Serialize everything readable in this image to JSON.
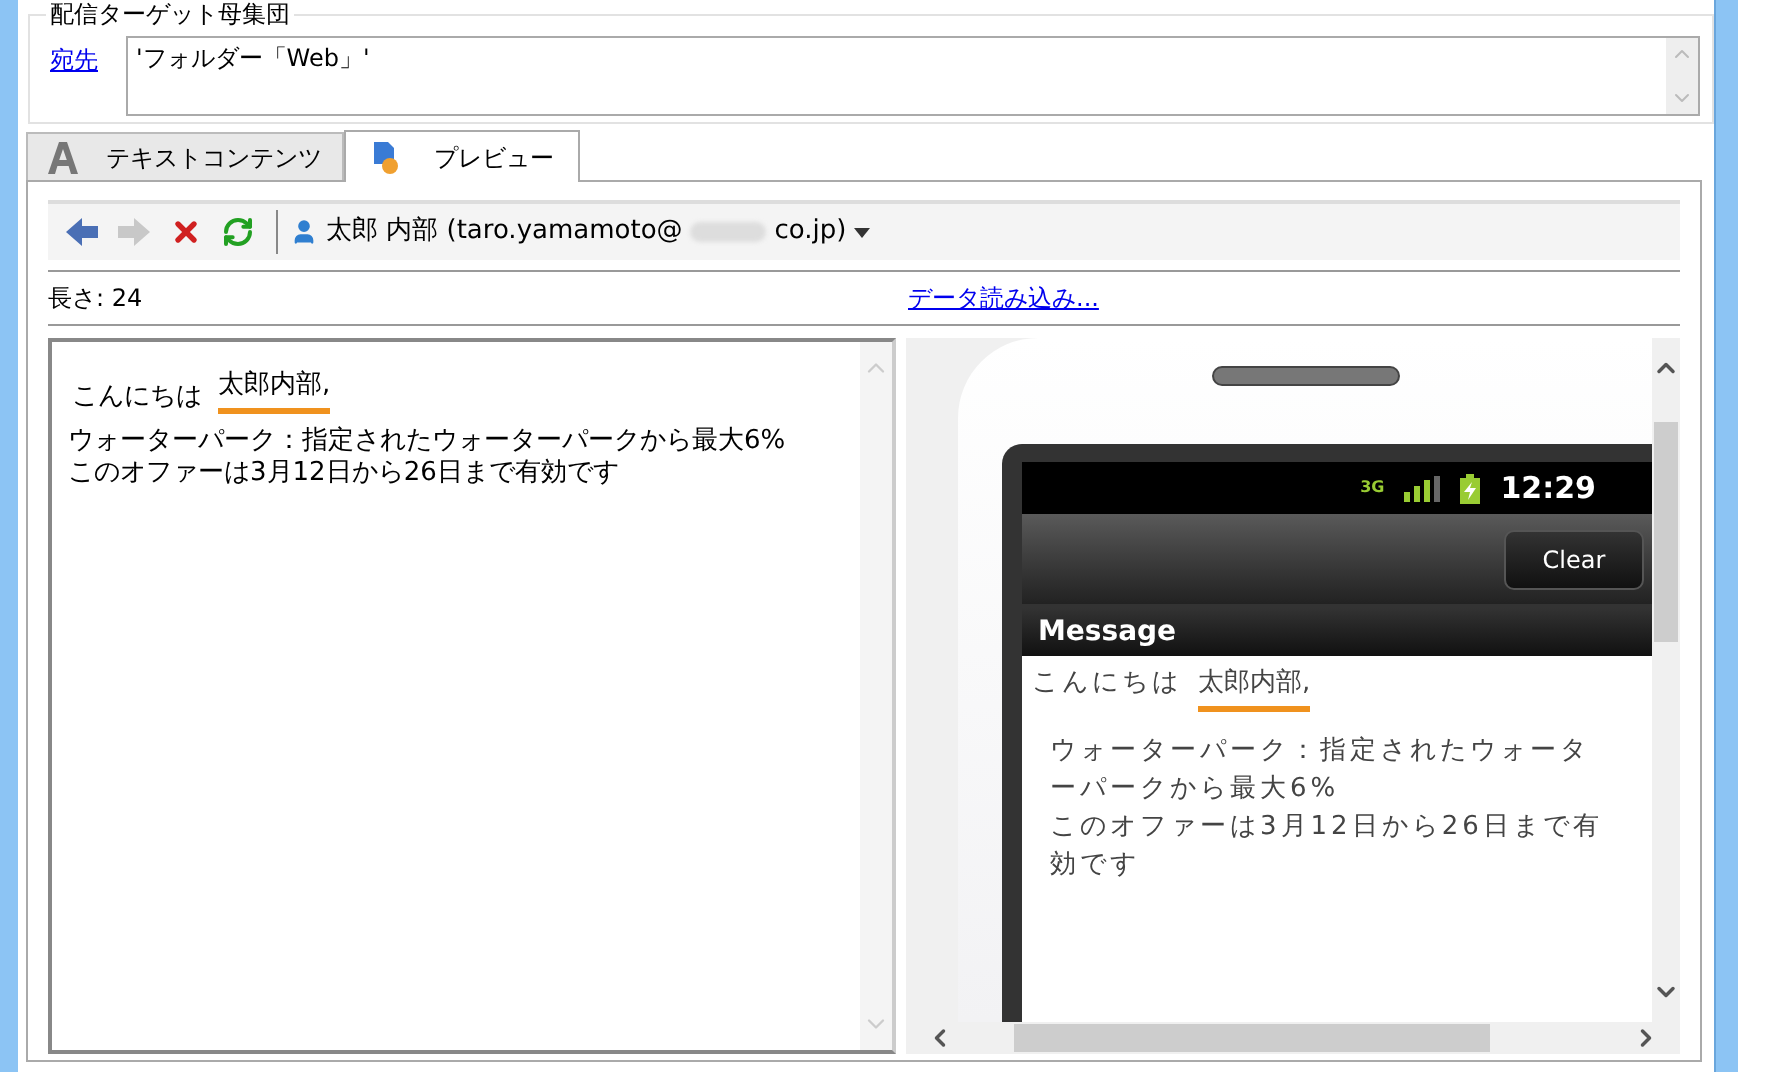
{
  "group": {
    "title": "配信ターゲット母集団",
    "to_link": "宛先",
    "to_value": "'フォルダー「Web」'"
  },
  "tabs": [
    {
      "label": "テキストコンテンツ",
      "selected": false,
      "kind": "text"
    },
    {
      "label": "プレビュー",
      "selected": true,
      "kind": "preview"
    }
  ],
  "toolbar": {
    "buttons": [
      {
        "kind": "back",
        "disabled": false
      },
      {
        "kind": "forward",
        "disabled": true
      },
      {
        "kind": "delete",
        "disabled": false
      },
      {
        "kind": "refresh",
        "disabled": false
      }
    ],
    "recipient_prefix": "太郎 内部 (taro.yamamoto@",
    "recipient_suffix": "co.jp)"
  },
  "length_label": "長さ: 24",
  "load_data_link": "データ読み込み...",
  "text_content": {
    "greeting": "こんにちは",
    "name": "太郎内部",
    "comma": ",",
    "lines": [
      "ウォーターパーク：指定されたウォーターパークから最大6%",
      "このオファーは3月12日から26日まで有効です"
    ]
  },
  "phone": {
    "network": "3G",
    "time": "12:29",
    "button": "Clear",
    "header": "Message",
    "greeting": "こんにちは",
    "name": "太郎内部",
    "comma": ",",
    "lines": [
      "ウォーターパーク：指定されたウォーターパークから最大6%",
      "このオファーは3月12日から26日まで有効です"
    ]
  }
}
